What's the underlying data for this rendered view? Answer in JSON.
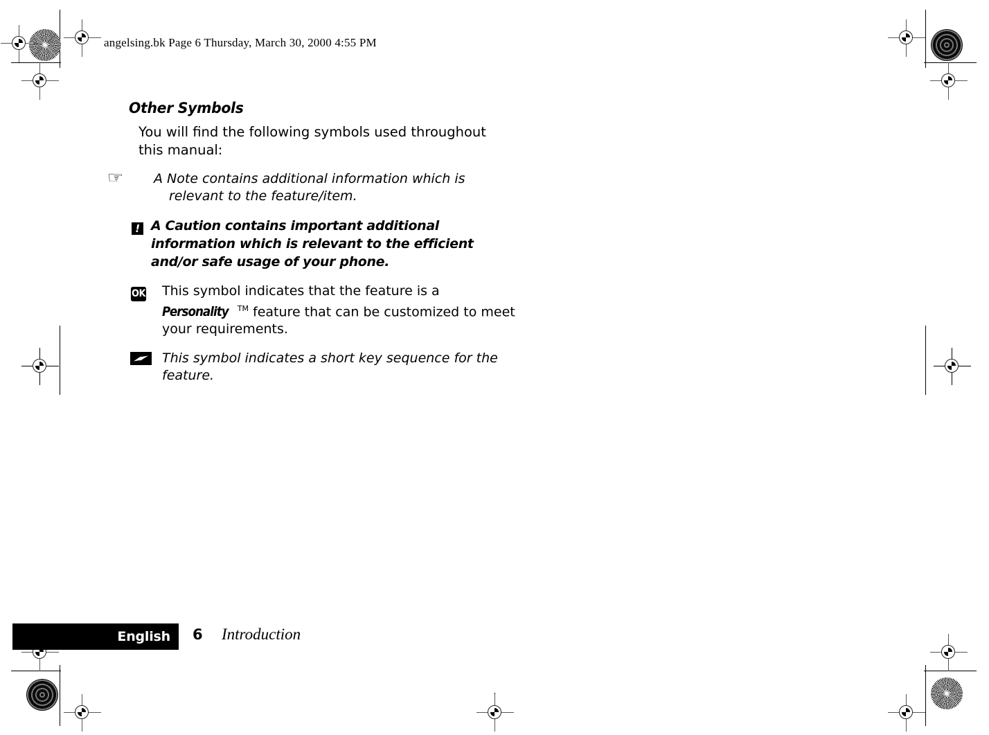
{
  "document": {
    "scan_header": "angelsing.bk  Page 6  Thursday, March 30, 2000  4:55 PM",
    "heading": "Other Symbols",
    "intro_paragraph": "You will find the following symbols used throughout this manual:",
    "symbols": [
      {
        "icon": "pointing-hand-icon",
        "glyph": "☞",
        "text": "A Note contains additional information which is relevant to the feature/item.",
        "style": "italic"
      },
      {
        "icon": "caution-exclamation-icon",
        "glyph": "!",
        "text": "A Caution contains important additional information which is relevant to the efficient and/or safe usage of your phone.",
        "style": "bold-italic"
      },
      {
        "icon": "ok-badge-icon",
        "glyph": "OK",
        "text_before": "This symbol indicates that the feature is a ",
        "brand": "Personality",
        "trademark": "TM",
        "text_after": " feature that can be customized to meet your requirements.",
        "style": "regular"
      },
      {
        "icon": "lightning-bolt-icon",
        "glyph": "⚡",
        "text": "This symbol indicates a short key sequence for the feature.",
        "style": "italic"
      }
    ]
  },
  "footer": {
    "language": "English",
    "page_number": "6",
    "chapter": "Introduction"
  },
  "print_marks": {
    "top_left_patch": "starburst-density-patch",
    "top_right_patch": "concentric-ring-density-patch",
    "bottom_left_patch": "concentric-ring-density-patch",
    "bottom_right_patch": "starburst-density-patch",
    "registration_target": "registration-crosshair"
  },
  "colors": {
    "ink": "#000000",
    "paper": "#ffffff",
    "mark_gray": "#555555"
  }
}
